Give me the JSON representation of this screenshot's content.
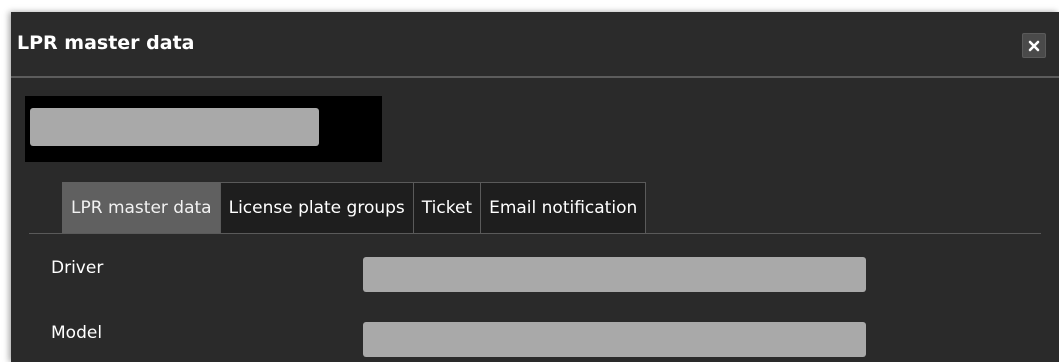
{
  "dialog": {
    "title": "LPR master data",
    "close_icon": "close-icon"
  },
  "tabs": [
    {
      "label": "LPR master data",
      "active": true
    },
    {
      "label": "License plate groups",
      "active": false
    },
    {
      "label": "Ticket",
      "active": false
    },
    {
      "label": "Email notification",
      "active": false
    }
  ],
  "fields": [
    {
      "label": "Driver",
      "value": ""
    },
    {
      "label": "Model",
      "value": ""
    }
  ],
  "colors": {
    "dialog_bg": "#2a2a2a",
    "active_tab_bg": "#606060",
    "field_bg": "#a9a9a9",
    "header_box_bg": "#000000"
  }
}
